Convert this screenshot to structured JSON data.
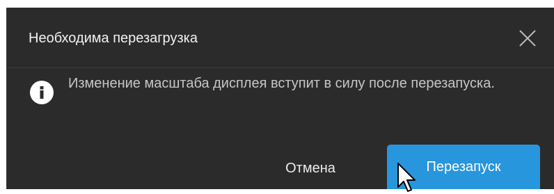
{
  "dialog": {
    "title": "Необходима перезагрузка",
    "message": "Изменение масштаба дисплея вступит в силу после перезапуска.",
    "cancel_label": "Отмена",
    "confirm_label": "Перезапуск"
  },
  "icons": {
    "close": "close-icon",
    "info": "info-icon",
    "cursor": "mouse-pointer-icon"
  },
  "colors": {
    "dialog_background": "#2b2b2b",
    "primary_button": "#2796dc",
    "title_text": "#f2f2f2",
    "body_text": "#c6c6c6"
  }
}
